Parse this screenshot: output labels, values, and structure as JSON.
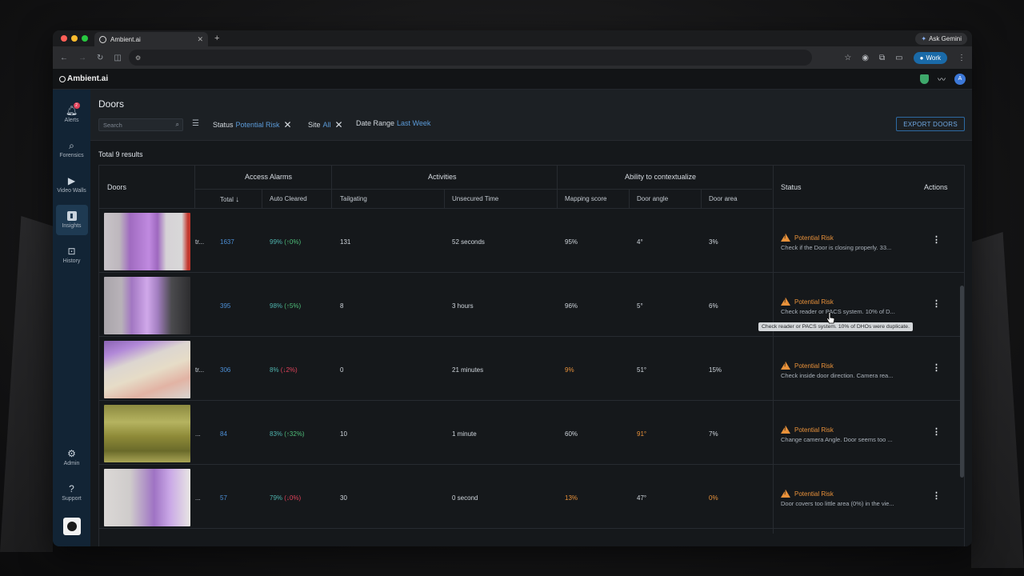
{
  "browser": {
    "tab_title": "Ambient.ai",
    "ask_gemini": "Ask Gemini",
    "profile_label": "Work"
  },
  "app": {
    "brand": "Ambient.ai",
    "avatar_letter": "A"
  },
  "sidebar": {
    "items": [
      {
        "label": "Alerts",
        "icon": "bell-icon",
        "badge": "2"
      },
      {
        "label": "Forensics",
        "icon": "search-icon"
      },
      {
        "label": "Video Walls",
        "icon": "video-icon"
      },
      {
        "label": "Insights",
        "icon": "bar-chart-icon"
      },
      {
        "label": "History",
        "icon": "history-icon"
      }
    ],
    "bottom": [
      {
        "label": "Admin",
        "icon": "gear-icon"
      },
      {
        "label": "Support",
        "icon": "help-icon"
      }
    ]
  },
  "page": {
    "title": "Doors",
    "search_placeholder": "Search",
    "filters": [
      {
        "name": "Status",
        "value": "Potential Risk"
      },
      {
        "name": "Site",
        "value": "All"
      },
      {
        "name": "Date Range",
        "value": "Last Week"
      }
    ],
    "export_label": "EXPORT DOORS",
    "total_results": "Total 9 results"
  },
  "table": {
    "groups": {
      "doors": "Doors",
      "access_alarms": "Access Alarms",
      "activities": "Activities",
      "context": "Ability to contextualize",
      "status": "Status",
      "actions": "Actions"
    },
    "columns": {
      "total": "Total",
      "auto_cleared": "Auto Cleared",
      "tailgating": "Tailgating",
      "unsecured_time": "Unsecured Time",
      "mapping_score": "Mapping score",
      "door_angle": "Door angle",
      "door_area": "Door area"
    },
    "rows": [
      {
        "name": "tr...",
        "total": "1637",
        "auto_pct": "99%",
        "auto_delta": "(↑0%)",
        "tailgating": "131",
        "unsecured": "52 seconds",
        "mapping": "95%",
        "angle": "4°",
        "area": "3%",
        "status": "Potential Risk",
        "status_msg": "Check if the Door is closing properly. 33..."
      },
      {
        "name": "",
        "total": "395",
        "auto_pct": "98%",
        "auto_delta": "(↑5%)",
        "tailgating": "8",
        "unsecured": "3 hours",
        "mapping": "96%",
        "angle": "5°",
        "area": "6%",
        "status": "Potential Risk",
        "status_msg": "Check reader or PACS system. 10% of D..."
      },
      {
        "name": "tr...",
        "total": "306",
        "auto_pct": "8%",
        "auto_delta": "(↓2%)",
        "tailgating": "0",
        "unsecured": "21 minutes",
        "mapping": "9%",
        "angle": "51°",
        "area": "15%",
        "status": "Potential Risk",
        "status_msg": "Check inside door direction. Camera rea..."
      },
      {
        "name": "...",
        "total": "84",
        "auto_pct": "83%",
        "auto_delta": "(↑32%)",
        "tailgating": "10",
        "unsecured": "1 minute",
        "mapping": "60%",
        "angle": "91°",
        "area": "7%",
        "status": "Potential Risk",
        "status_msg": "Change camera Angle. Door seems too ..."
      },
      {
        "name": "...",
        "total": "57",
        "auto_pct": "79%",
        "auto_delta": "(↓0%)",
        "tailgating": "30",
        "unsecured": "0 second",
        "mapping": "13%",
        "angle": "47°",
        "area": "0%",
        "status": "Potential Risk",
        "status_msg": "Door covers too little area (0%) in the vie..."
      }
    ],
    "tooltip": "Check reader or PACS system. 10% of DHOs were duplicate."
  },
  "colors": {
    "accent_blue": "#4c8fd6",
    "warning_orange": "#e8913a",
    "up_green": "#4fbf7a",
    "down_red": "#e0425a"
  }
}
